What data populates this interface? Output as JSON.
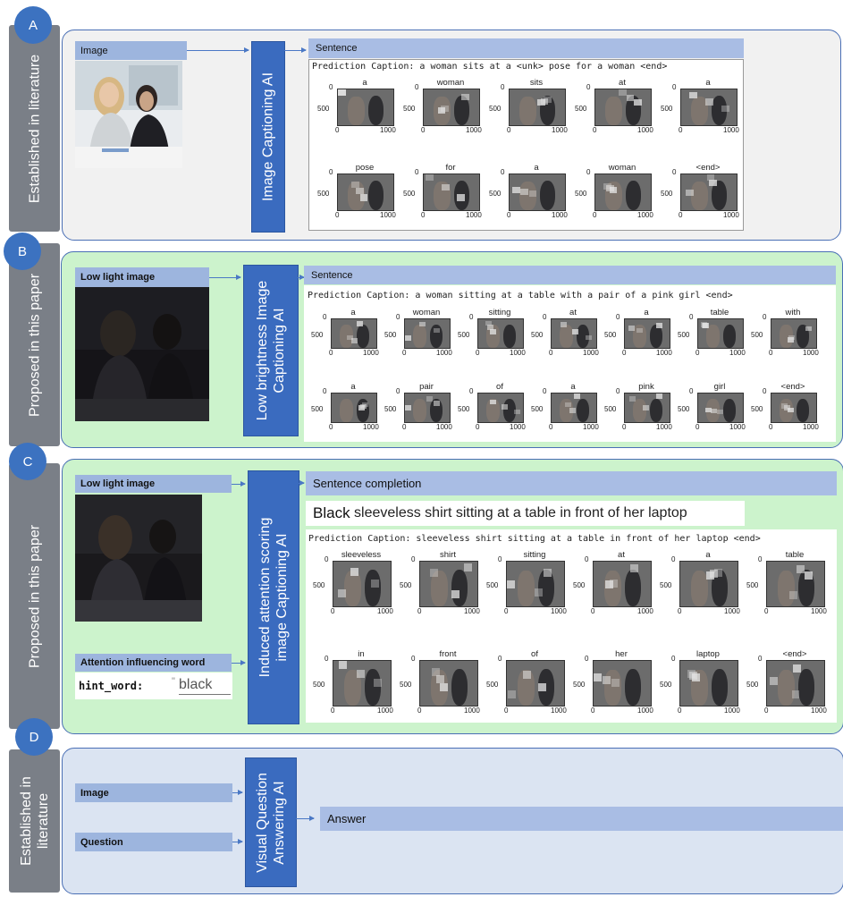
{
  "sections": {
    "a": {
      "letter": "A",
      "side_label": "Established in literature",
      "input_label": "Image",
      "ai_label": "Image Captioning AI",
      "output_label": "Sentence",
      "prediction": "Prediction Caption: a woman sits at a <unk> pose for a woman <end>",
      "words": [
        "a",
        "woman",
        "sits",
        "at",
        "a",
        "pose",
        "for",
        "a",
        "woman",
        "<end>"
      ]
    },
    "b": {
      "letter": "B",
      "side_label": "Proposed in this paper",
      "input_label": "Low light image",
      "ai_label_line1": "Low brightness Image",
      "ai_label_line2": "Captioning AI",
      "output_label": "Sentence",
      "prediction": "Prediction Caption: a woman sitting at a table with a pair of a pink girl <end>",
      "words": [
        "a",
        "woman",
        "sitting",
        "at",
        "a",
        "table",
        "with",
        "a",
        "pair",
        "of",
        "a",
        "pink",
        "girl",
        "<end>"
      ]
    },
    "c": {
      "letter": "C",
      "side_label": "Proposed in this paper",
      "input_label": "Low light image",
      "influence_label": "Attention influencing word",
      "hint_key": "hint_word:",
      "hint_quote": "\"",
      "hint_value": "black",
      "ai_label_line1": "Induced attention scoring",
      "ai_label_line2": "image Captioning AI",
      "output_label": "Sentence completion",
      "completion_bold": "Black",
      "completion_rest": "sleeveless shirt sitting at a table in front of her laptop",
      "prediction": "Prediction Caption: sleeveless shirt sitting at a table in front of her laptop <end>",
      "words": [
        "sleeveless",
        "shirt",
        "sitting",
        "at",
        "a",
        "table",
        "in",
        "front",
        "of",
        "her",
        "laptop",
        "<end>"
      ]
    },
    "d": {
      "letter": "D",
      "side_label_line1": "Established in",
      "side_label_line2": "literature",
      "input1_label": "Image",
      "input2_label": "Question",
      "ai_label_line1": "Visual Question",
      "ai_label_line2": "Answering AI",
      "output_label": "Answer"
    }
  },
  "axis_ticks": {
    "y0": "0",
    "y500": "500",
    "x0": "0",
    "x1000": "1000"
  },
  "colors": {
    "panel_a_bg": "#f1f1f1",
    "panel_b_bg": "#ccf3cc",
    "panel_c_bg": "#ccf3cc",
    "panel_d_bg": "#dbe4f2",
    "ai_block": "#3a6bbf",
    "label_bar": "#9db5de",
    "badge": "#3c72c0",
    "sidebar": "#7a7f87"
  }
}
